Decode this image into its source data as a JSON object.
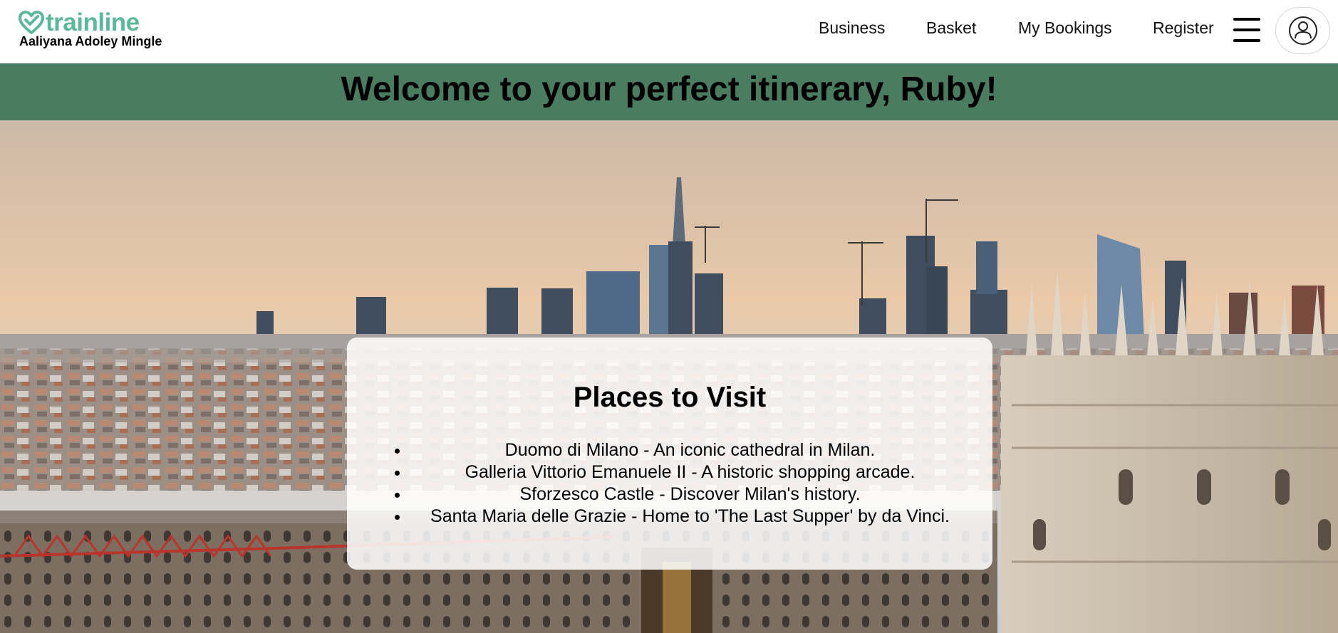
{
  "header": {
    "brand": "trainline",
    "subtitle": "Aaliyana Adoley Mingle",
    "brand_color": "#5cb89a",
    "nav": [
      {
        "label": "Business"
      },
      {
        "label": "Basket"
      },
      {
        "label": "My Bookings"
      },
      {
        "label": "Register"
      }
    ],
    "menu_icon": "hamburger-menu-icon",
    "account_icon": "user-account-icon"
  },
  "banner": {
    "title": "Welcome to your perfect itinerary, Ruby!",
    "background_color": "#4a7c5f"
  },
  "hero": {
    "image": "Milan city skyline with Duomo cathedral spires"
  },
  "places": {
    "heading": "Places to Visit",
    "items": [
      "Duomo di Milano - An iconic cathedral in Milan.",
      "Galleria Vittorio Emanuele II - A historic shopping arcade.",
      "Sforzesco Castle - Discover Milan's history.",
      "Santa Maria delle Grazie - Home to 'The Last Supper' by da Vinci."
    ]
  }
}
